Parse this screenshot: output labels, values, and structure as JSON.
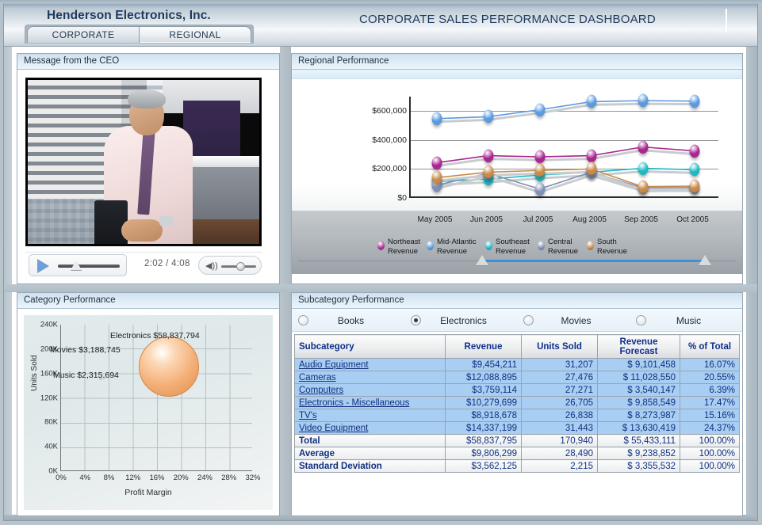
{
  "header": {
    "company_name": "Henderson Electronics, Inc.",
    "dashboard_title": "CORPORATE SALES PERFORMANCE DASHBOARD",
    "tabs": [
      {
        "label": "CORPORATE",
        "active": false
      },
      {
        "label": "REGIONAL",
        "active": true
      }
    ]
  },
  "ceo_panel": {
    "title": "Message from the CEO",
    "player": {
      "play_icon": "play-icon",
      "time_display": "2:02 / 4:08",
      "volume_icon": "speaker-icon",
      "seek_position_pct": 30,
      "volume_position_pct": 55
    }
  },
  "category_panel": {
    "title": "Category Performance"
  },
  "regional_panel": {
    "title": "Regional Performance",
    "range_slider": {
      "left_handle_pct": 42,
      "right_handle_pct": 93
    }
  },
  "subcategory_panel": {
    "title": "Subcategory Performance",
    "radio_options": [
      {
        "label": "Books",
        "selected": false
      },
      {
        "label": "Electronics",
        "selected": true
      },
      {
        "label": "Movies",
        "selected": false
      },
      {
        "label": "Music",
        "selected": false
      }
    ],
    "columns": [
      "Subcategory",
      "Revenue",
      "Units Sold",
      "Revenue\nForecast",
      "% of Total"
    ],
    "rows": [
      {
        "name": "Audio Equipment",
        "revenue": "$9,454,211",
        "units": "31,207",
        "forecast": "$ 9,101,458",
        "pct": "16.07%",
        "summary": false
      },
      {
        "name": "Cameras",
        "revenue": "$12,088,895",
        "units": "27,476",
        "forecast": "$ 11,028,550",
        "pct": "20.55%",
        "summary": false
      },
      {
        "name": "Computers",
        "revenue": "$3,759,114",
        "units": "27,271",
        "forecast": "$ 3,540,147",
        "pct": "6.39%",
        "summary": false
      },
      {
        "name": "Electronics - Miscellaneous",
        "revenue": "$10,279,699",
        "units": "26,705",
        "forecast": "$ 9,858,549",
        "pct": "17.47%",
        "summary": false
      },
      {
        "name": "TV's",
        "revenue": "$8,918,678",
        "units": "26,838",
        "forecast": "$ 8,273,987",
        "pct": "15.16%",
        "summary": false
      },
      {
        "name": "Video Equipment",
        "revenue": "$14,337,199",
        "units": "31,443",
        "forecast": "$ 13,630,419",
        "pct": "24.37%",
        "summary": false
      },
      {
        "name": "Total",
        "revenue": "$58,837,795",
        "units": "170,940",
        "forecast": "$ 55,433,111",
        "pct": "100.00%",
        "summary": true
      },
      {
        "name": "Average",
        "revenue": "$9,806,299",
        "units": "28,490",
        "forecast": "$ 9,238,852",
        "pct": "100.00%",
        "summary": true
      },
      {
        "name": "Standard Deviation",
        "revenue": "$3,562,125",
        "units": "2,215",
        "forecast": "$ 3,355,532",
        "pct": "100.00%",
        "summary": true
      }
    ]
  },
  "colors": {
    "northeast": "#a8268f",
    "mid_atlantic": "#5b9ae0",
    "southeast": "#1fb9c4",
    "central": "#7f8fb5",
    "south": "#c98a48",
    "accent_blue": "#3f8fd8",
    "table_cell": "#a8cef3",
    "table_text": "#12307f",
    "bubble_orange": "#f3ad74"
  },
  "chart_data": [
    {
      "type": "line",
      "title": "Regional Performance",
      "xlabel": "",
      "ylabel": "",
      "x": [
        "May 2005",
        "Jun 2005",
        "Jul 2005",
        "Aug 2005",
        "Sep 2005",
        "Oct 2005"
      ],
      "ylim": [
        0,
        700000
      ],
      "yticks": [
        "$0",
        "$200,000",
        "$400,000",
        "$600,000"
      ],
      "ytick_values": [
        0,
        200000,
        400000,
        600000
      ],
      "grid": true,
      "legend_position": "bottom",
      "series": [
        {
          "name": "Northeast Revenue",
          "color": "#a8268f",
          "values": [
            243000,
            292000,
            284000,
            292000,
            352000,
            325000
          ]
        },
        {
          "name": "Mid-Atlantic Revenue",
          "color": "#5b9ae0",
          "values": [
            548000,
            561000,
            609000,
            665000,
            672000,
            669000
          ]
        },
        {
          "name": "Southeast Revenue",
          "color": "#1fb9c4",
          "values": [
            113000,
            130000,
            158000,
            178000,
            205000,
            195000
          ]
        },
        {
          "name": "Central Revenue",
          "color": "#7f8fb5",
          "values": [
            88000,
            170000,
            62000,
            178000,
            70000,
            72000
          ]
        },
        {
          "name": "South Revenue",
          "color": "#c98a48",
          "values": [
            140000,
            178000,
            190000,
            200000,
            78000,
            82000
          ]
        }
      ]
    },
    {
      "type": "scatter",
      "title": "Category Performance",
      "xlabel": "Profit Margin",
      "ylabel": "Units Sold",
      "xticks": [
        "0%",
        "4%",
        "8%",
        "12%",
        "16%",
        "20%",
        "24%",
        "28%",
        "32%"
      ],
      "xtick_values": [
        0,
        4,
        8,
        12,
        16,
        20,
        24,
        28,
        32
      ],
      "yticks": [
        "0K",
        "40K",
        "80K",
        "120K",
        "160K",
        "200K",
        "240K"
      ],
      "ytick_values": [
        0,
        40,
        80,
        120,
        160,
        200,
        240
      ],
      "xlim": [
        0,
        32
      ],
      "ylim": [
        0,
        240
      ],
      "grid": true,
      "points": [
        {
          "label": "Electronics $58,837,794",
          "x": 18.0,
          "y": 171,
          "size": 76,
          "color": "#f3ad74"
        },
        {
          "label": "Movies $3,188,745",
          "x": 6.6,
          "y": 200,
          "size": 5,
          "color": "#cfd9c2"
        },
        {
          "label": "Music $2,315,694",
          "x": 6.6,
          "y": 152,
          "size": 4,
          "color": "#cfd9c2"
        }
      ]
    },
    {
      "type": "table",
      "title": "Subcategory Performance",
      "columns": [
        "Subcategory",
        "Revenue",
        "Units Sold",
        "Revenue Forecast",
        "% of Total"
      ],
      "rows": [
        [
          "Audio Equipment",
          9454211,
          31207,
          9101458,
          16.07
        ],
        [
          "Cameras",
          12088895,
          27476,
          11028550,
          20.55
        ],
        [
          "Computers",
          3759114,
          27271,
          3540147,
          6.39
        ],
        [
          "Electronics - Miscellaneous",
          10279699,
          26705,
          9858549,
          17.47
        ],
        [
          "TV's",
          8918678,
          26838,
          8273987,
          15.16
        ],
        [
          "Video Equipment",
          14337199,
          31443,
          13630419,
          24.37
        ],
        [
          "Total",
          58837795,
          170940,
          55433111,
          100.0
        ],
        [
          "Average",
          9806299,
          28490,
          9238852,
          100.0
        ],
        [
          "Standard Deviation",
          3562125,
          2215,
          3355532,
          100.0
        ]
      ]
    }
  ]
}
